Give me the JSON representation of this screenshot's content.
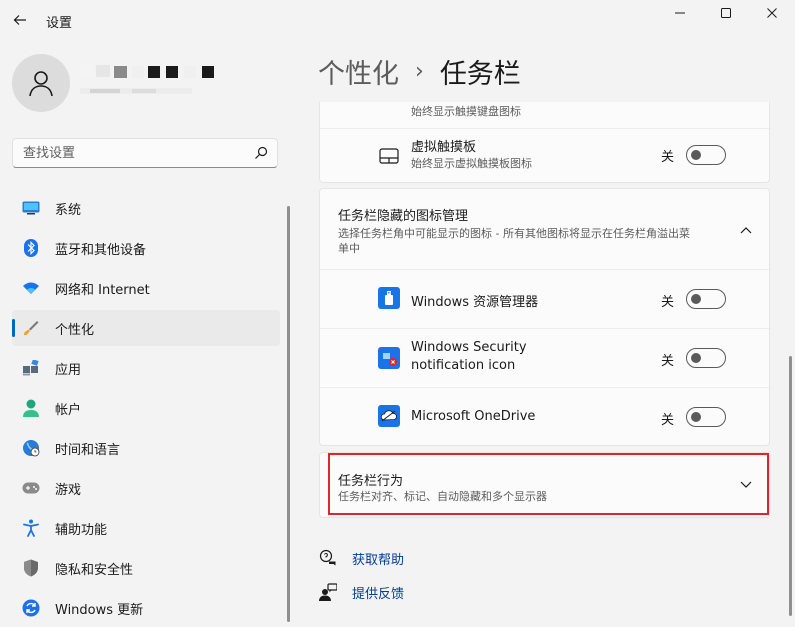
{
  "window": {
    "title": "设置"
  },
  "search": {
    "placeholder": "查找设置"
  },
  "nav": {
    "items": [
      {
        "label": "系统"
      },
      {
        "label": "蓝牙和其他设备"
      },
      {
        "label": "网络和 Internet"
      },
      {
        "label": "个性化",
        "active": true
      },
      {
        "label": "应用"
      },
      {
        "label": "帐户"
      },
      {
        "label": "时间和语言"
      },
      {
        "label": "游戏"
      },
      {
        "label": "辅助功能"
      },
      {
        "label": "隐私和安全性"
      },
      {
        "label": "Windows 更新"
      }
    ]
  },
  "breadcrumb": {
    "parent": "个性化",
    "separator": "›",
    "current": "任务栏"
  },
  "pen_row": {
    "desc": "始终显示触摸键盘图标"
  },
  "touchpad_row": {
    "title": "虚拟触摸板",
    "desc": "始终显示虚拟触摸板图标",
    "state_label": "关",
    "on": false
  },
  "overflow_section": {
    "title": "任务栏隐藏的图标管理",
    "desc_line1": "选择任务栏角中可能显示的图标 - 所有其他图标将显示在任务栏角溢出菜",
    "desc_line2": "单中",
    "items": [
      {
        "title": "Windows 资源管理器",
        "state_label": "关",
        "on": false
      },
      {
        "title_line1": "Windows Security",
        "title_line2": "notification icon",
        "state_label": "关",
        "on": false
      },
      {
        "title": "Microsoft OneDrive",
        "state_label": "关",
        "on": false
      }
    ]
  },
  "behaviors_section": {
    "title": "任务栏行为",
    "desc": "任务栏对齐、标记、自动隐藏和多个显示器"
  },
  "links": {
    "help": "获取帮助",
    "feedback": "提供反馈"
  },
  "colors": {
    "accent": "#0067c0",
    "highlight_border": "#e0242a",
    "link": "#003e92"
  }
}
